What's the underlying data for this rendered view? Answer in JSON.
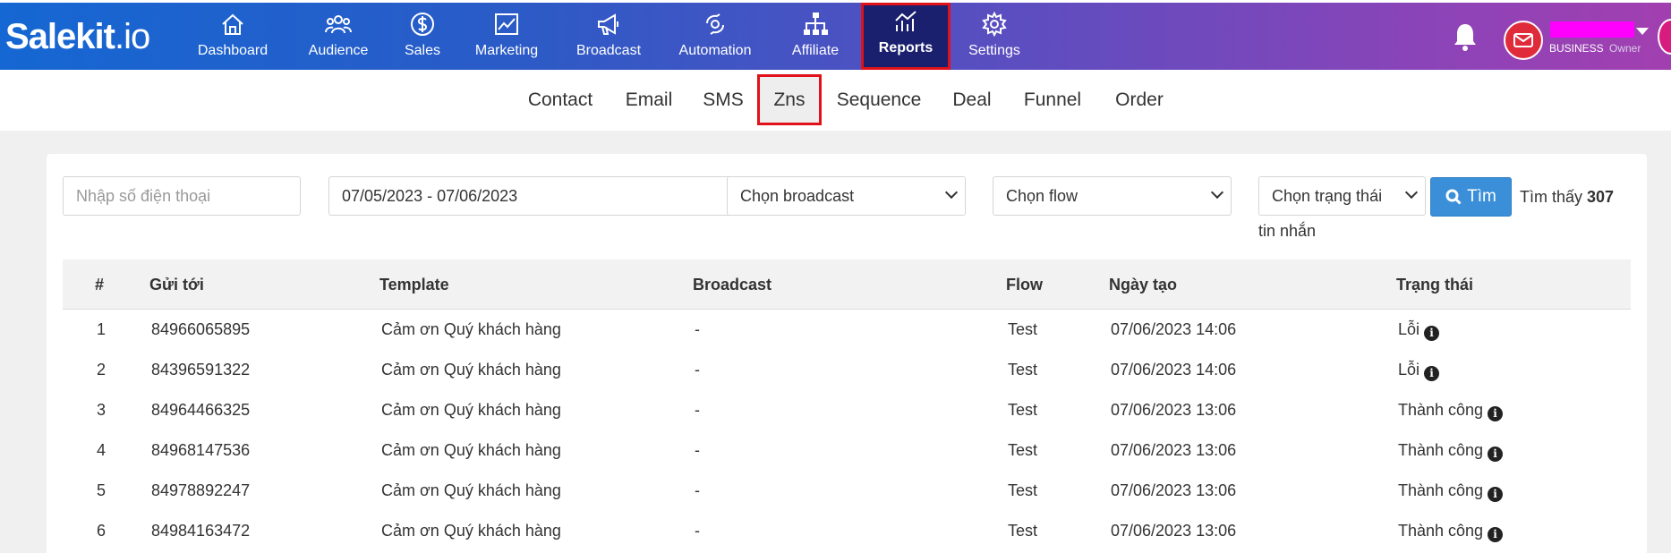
{
  "brand": {
    "name": "Salekit",
    "suffix": ".io"
  },
  "nav": [
    {
      "label": "Dashboard",
      "icon": "home-icon"
    },
    {
      "label": "Audience",
      "icon": "users-icon"
    },
    {
      "label": "Sales",
      "icon": "dollar-icon"
    },
    {
      "label": "Marketing",
      "icon": "chart-line-icon"
    },
    {
      "label": "Broadcast",
      "icon": "megaphone-icon"
    },
    {
      "label": "Automation",
      "icon": "automation-icon"
    },
    {
      "label": "Affiliate",
      "icon": "sitemap-icon"
    },
    {
      "label": "Reports",
      "icon": "reports-icon"
    },
    {
      "label": "Settings",
      "icon": "gear-icon"
    }
  ],
  "active_nav": "Reports",
  "user": {
    "plan": "BUSINESS",
    "role": "Owner"
  },
  "subtabs": [
    "Contact",
    "Email",
    "SMS",
    "Zns",
    "Sequence",
    "Deal",
    "Funnel",
    "Order"
  ],
  "active_subtab": "Zns",
  "filters": {
    "phone_placeholder": "Nhập số điện thoại",
    "date_range": "07/05/2023 - 07/06/2023",
    "broadcast_select": "Chọn broadcast",
    "flow_select": "Chọn flow",
    "status_select": "Chọn trạng thái",
    "search_label": "Tìm",
    "found_prefix": "Tìm thấy",
    "found_count": "307",
    "found_suffix": "tin nhắn"
  },
  "table": {
    "headers": [
      "#",
      "Gửi tới",
      "Template",
      "Broadcast",
      "Flow",
      "Ngày tạo",
      "Trạng thái"
    ],
    "rows": [
      {
        "no": "1",
        "to": "84966065895",
        "template": "Cảm ơn Quý khách hàng",
        "broadcast": "-",
        "flow": "Test",
        "created": "07/06/2023 14:06",
        "status": "Lỗi"
      },
      {
        "no": "2",
        "to": "84396591322",
        "template": "Cảm ơn Quý khách hàng",
        "broadcast": "-",
        "flow": "Test",
        "created": "07/06/2023 14:06",
        "status": "Lỗi"
      },
      {
        "no": "3",
        "to": "84964466325",
        "template": "Cảm ơn Quý khách hàng",
        "broadcast": "-",
        "flow": "Test",
        "created": "07/06/2023 13:06",
        "status": "Thành công"
      },
      {
        "no": "4",
        "to": "84968147536",
        "template": "Cảm ơn Quý khách hàng",
        "broadcast": "-",
        "flow": "Test",
        "created": "07/06/2023 13:06",
        "status": "Thành công"
      },
      {
        "no": "5",
        "to": "84978892247",
        "template": "Cảm ơn Quý khách hàng",
        "broadcast": "-",
        "flow": "Test",
        "created": "07/06/2023 13:06",
        "status": "Thành công"
      },
      {
        "no": "6",
        "to": "84984163472",
        "template": "Cảm ơn Quý khách hàng",
        "broadcast": "-",
        "flow": "Test",
        "created": "07/06/2023 13:06",
        "status": "Thành công"
      }
    ]
  },
  "colors": {
    "highlight": "#e1111a",
    "primary": "#3a8fd8",
    "active_nav": "#1a1f6e"
  }
}
